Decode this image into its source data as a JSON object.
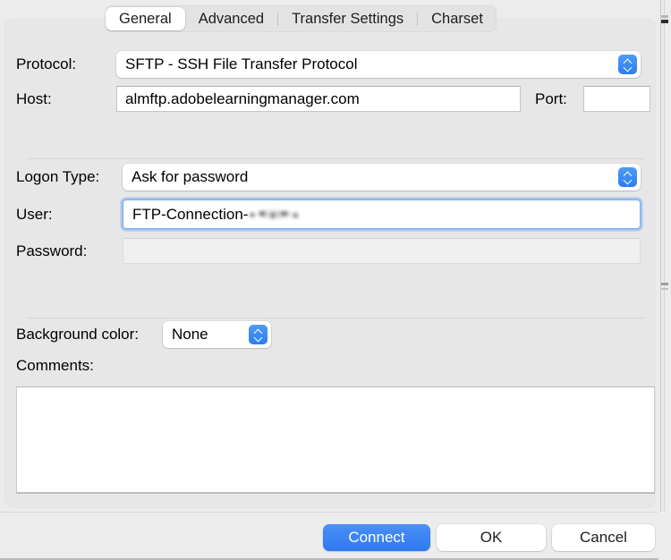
{
  "window": {
    "kind": "site-manager-connection-dialog"
  },
  "tabs": [
    {
      "label": "General",
      "selected": true
    },
    {
      "label": "Advanced",
      "selected": false
    },
    {
      "label": "Transfer Settings",
      "selected": false
    },
    {
      "label": "Charset",
      "selected": false
    }
  ],
  "form": {
    "protocol": {
      "label": "Protocol:",
      "value": "SFTP - SSH File Transfer Protocol"
    },
    "host": {
      "label": "Host:",
      "value": "almftp.adobelearningmanager.com",
      "placeholder": ""
    },
    "port": {
      "label": "Port:",
      "value": "",
      "placeholder": ""
    },
    "logon_type": {
      "label": "Logon Type:",
      "value": "Ask for password"
    },
    "user": {
      "label": "User:",
      "value": "FTP-Connection-",
      "redacted_suffix": true,
      "focused": true,
      "placeholder": ""
    },
    "password": {
      "label": "Password:",
      "value": "",
      "placeholder": "",
      "disabled": true
    },
    "background_color": {
      "label": "Background color:",
      "value": "None"
    },
    "comments": {
      "label": "Comments:",
      "value": "",
      "placeholder": ""
    }
  },
  "buttons": {
    "connect": "Connect",
    "ok": "OK",
    "cancel": "Cancel"
  },
  "icons": {
    "stepper": "up-down-chevron-icon"
  },
  "colors": {
    "accent": "#2f78f0",
    "window_bg": "#ececec",
    "panel_bg": "#e7e7e7",
    "field_bg": "#ffffff",
    "focus_ring": "#a8c7f0",
    "text": "#000000"
  }
}
